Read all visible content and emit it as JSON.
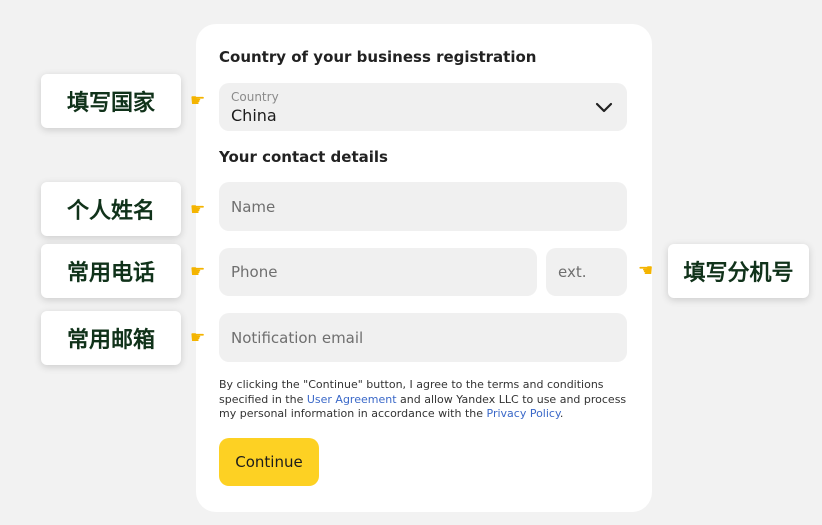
{
  "form": {
    "country_section_title": "Country of your business registration",
    "country_label": "Country",
    "country_value": "China",
    "contact_section_title": "Your contact details",
    "name_placeholder": "Name",
    "phone_placeholder": "Phone",
    "ext_placeholder": "ext.",
    "email_placeholder": "Notification email",
    "terms_part1": "By clicking the \"Continue\" button, I agree to the terms and conditions specified in the ",
    "user_agreement_link": "User Agreement",
    "terms_part2": " and allow Yandex LLC to use and process my personal information in accordance with the ",
    "privacy_policy_link": "Privacy Policy",
    "terms_part3": ".",
    "continue_label": "Continue"
  },
  "annotations": {
    "country": "填写国家",
    "name": "个人姓名",
    "phone": "常用电话",
    "email": "常用邮箱",
    "ext": "填写分机号"
  },
  "icons": {
    "pointer": "pointing-hand-icon",
    "dropdown": "chevron-down-icon"
  },
  "colors": {
    "background": "#f2f2f2",
    "card": "#ffffff",
    "field": "#f0f0f0",
    "continue_button": "#fdd123",
    "link": "#3a68c8",
    "annotation_text": "#10321a",
    "pointer_hand": "#f4b400"
  }
}
